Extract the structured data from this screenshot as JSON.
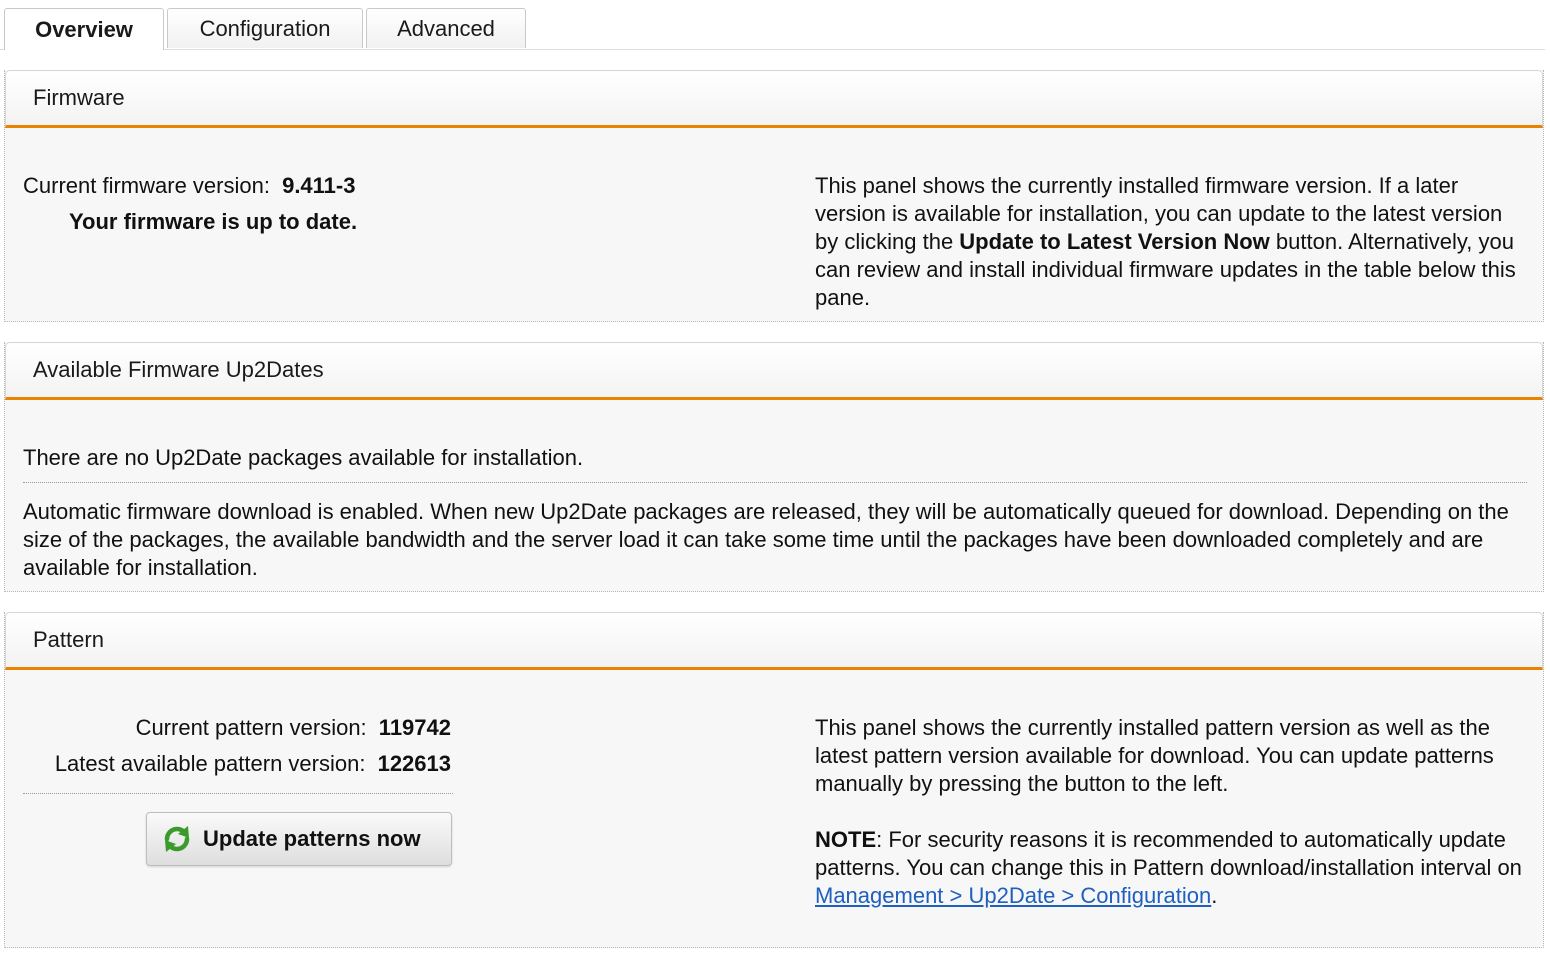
{
  "tabs": [
    {
      "label": "Overview",
      "active": true
    },
    {
      "label": "Configuration",
      "active": false
    },
    {
      "label": "Advanced",
      "active": false
    }
  ],
  "firmware": {
    "title": "Firmware",
    "current_label": "Current firmware version:",
    "current_value": "9.411-3",
    "status": "Your firmware is up to date.",
    "help_part1": "This panel shows the currently installed firmware version. If a later version is available for installation, you can update to the latest version by clicking the ",
    "help_bold": "Update to Latest Version Now",
    "help_part2": " button. Alternatively, you can review and install individual firmware updates in the table below this pane."
  },
  "up2dates": {
    "title": "Available Firmware Up2Dates",
    "none_text": "There are no Up2Date packages available for installation.",
    "auto_text": "Automatic firmware download is enabled. When new Up2Date packages are released, they will be automatically queued for download. Depending on the size of the packages, the available bandwidth and the server load it can take some time until the packages have been downloaded completely and are available for installation."
  },
  "pattern": {
    "title": "Pattern",
    "current_label": "Current pattern version:",
    "current_value": "119742",
    "latest_label": "Latest available pattern version:",
    "latest_value": "122613",
    "button_label": "Update patterns now",
    "button_icon": "refresh-icon",
    "help": "This panel shows the currently installed pattern version as well as the latest pattern version available for download. You can update patterns manually by pressing the button to the left.",
    "note_label": "NOTE",
    "note_text": ": For security reasons it is recommended to automatically update patterns. You can change this in Pattern download/installation interval on ",
    "note_link": "Management > Up2Date > Configuration",
    "note_end": "."
  },
  "colors": {
    "accent": "#e98300",
    "link": "#1f5fbf",
    "icon_green": "#3a9a2a"
  }
}
